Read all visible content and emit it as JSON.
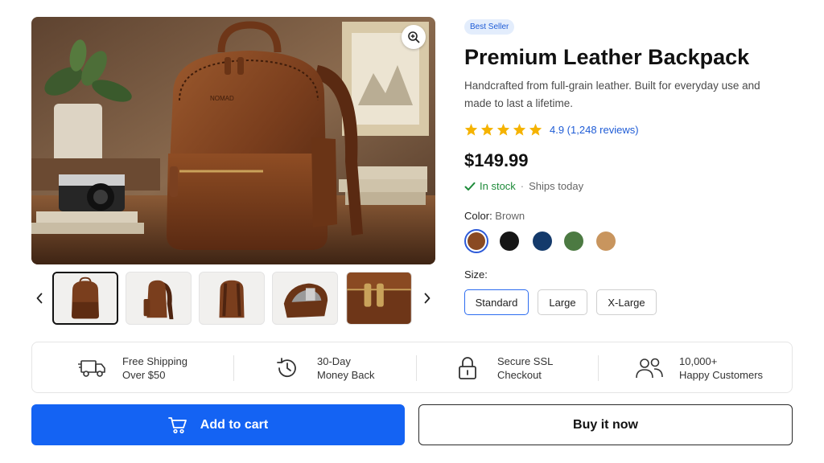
{
  "product": {
    "badge": "Best Seller",
    "title": "Premium Leather Backpack",
    "description": "Handcrafted from full-grain leather. Built for everyday use and made to last a lifetime.",
    "brand_mark": "NOMAD",
    "rating": {
      "stars": 5,
      "text": "4.9 (1,248 reviews)"
    },
    "price": "$149.99",
    "stock": {
      "status": "In stock",
      "separator": "·",
      "shipping": "Ships today"
    }
  },
  "color": {
    "label": "Color:",
    "selected": "Brown",
    "swatches": [
      {
        "name": "Brown",
        "hex": "#8a4a22"
      },
      {
        "name": "Black",
        "hex": "#161616"
      },
      {
        "name": "Navy",
        "hex": "#143a6b"
      },
      {
        "name": "Green",
        "hex": "#4c7a42"
      },
      {
        "name": "Tan",
        "hex": "#c8955e"
      }
    ]
  },
  "size": {
    "label": "Size:",
    "options": [
      "Standard",
      "Large",
      "X-Large"
    ],
    "selected": "Standard"
  },
  "gallery": {
    "thumbnails": [
      "front",
      "side",
      "back",
      "interior",
      "detail"
    ],
    "active_index": 0
  },
  "features": [
    {
      "icon": "truck-icon",
      "line1": "Free Shipping",
      "line2": "Over $50"
    },
    {
      "icon": "history-icon",
      "line1": "30-Day",
      "line2": "Money Back"
    },
    {
      "icon": "lock-icon",
      "line1": "Secure SSL",
      "line2": "Checkout"
    },
    {
      "icon": "users-icon",
      "line1": "10,000+",
      "line2": "Happy Customers"
    }
  ],
  "actions": {
    "add_to_cart": "Add to cart",
    "buy_now": "Buy it now"
  },
  "colors": {
    "accent": "#1463f3",
    "link": "#1f5cd6",
    "star": "#f5b301",
    "success": "#1e8b3a",
    "leather": "#7a3e1d"
  }
}
